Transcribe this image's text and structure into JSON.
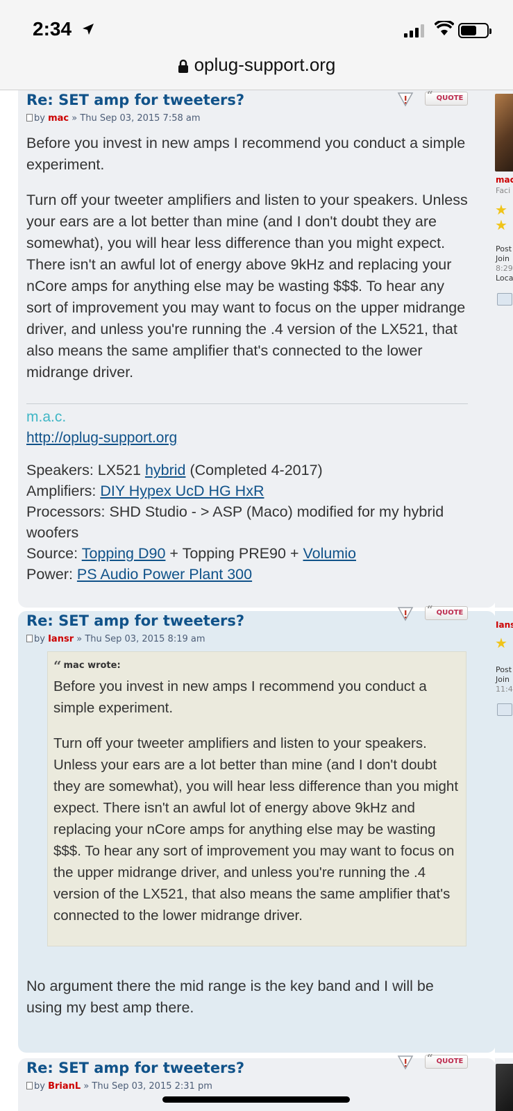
{
  "status_bar": {
    "time": "2:34",
    "url": "oplug-support.org"
  },
  "posts": [
    {
      "title": "Re: SET amp for tweeters?",
      "by": "by",
      "author": "mac",
      "date": "» Thu Sep 03, 2015 7:58 am",
      "quote_label": "QUOTE",
      "paragraphs": [
        "Before you invest in new amps I recommend you conduct a simple experiment.",
        "Turn off your tweeter amplifiers and listen to your speakers. Unless your ears are a lot better than mine (and I don't doubt they are somewhat), you will hear less difference than you might expect. There isn't an awful lot of energy above 9kHz and replacing your nCore amps for anything else may be wasting $$$. To hear any sort of improvement you may want to focus on the upper midrange driver, and unless you're running the .4 version of the LX521, that also means the same amplifier that's connected to the lower midrange driver."
      ],
      "signature": {
        "name": "m.a.c.",
        "link": "http://oplug-support.org",
        "speakers_label": "Speakers: LX521",
        "speakers_link": "hybrid",
        "speakers_suffix": "(Completed 4-2017)",
        "amplifiers_label": "Amplifiers:",
        "amplifiers_link": "DIY Hypex UcD HG HxR",
        "processors": "Processors: SHD Studio - > ASP (Maco) modified for my hybrid woofers",
        "source_label": "Source:",
        "source_link1": "Topping D90",
        "source_mid": "+ Topping PRE90 +",
        "source_link2": "Volumio",
        "power_label": "Power:",
        "power_link": "PS Audio Power Plant 300"
      },
      "profile": {
        "name": "mac",
        "rank": "Faci",
        "posts": "Post",
        "joined": "Join",
        "time": "8:29",
        "location": "Loca"
      }
    },
    {
      "title": "Re: SET amp for tweeters?",
      "by": "by",
      "author": "Iansr",
      "date": "» Thu Sep 03, 2015 8:19 am",
      "quote_label": "QUOTE",
      "quote": {
        "cite": "mac wrote:",
        "paragraphs": [
          "Before you invest in new amps I recommend you conduct a simple experiment.",
          "Turn off your tweeter amplifiers and listen to your speakers. Unless your ears are a lot better than mine (and I don't doubt they are somewhat), you will hear less difference than you might expect. There isn't an awful lot of energy above 9kHz and replacing your nCore amps for anything else may be wasting $$$. To hear any sort of improvement you may want to focus on the upper midrange driver, and unless you're running the .4 version of the LX521, that also means the same amplifier that's connected to the lower midrange driver."
        ]
      },
      "reply": "No argument there the mid range is the key band and I will be using my best amp there.",
      "profile": {
        "name": "Ians",
        "posts": "Post",
        "joined": "Join",
        "time": "11:4"
      }
    },
    {
      "title": "Re: SET amp for tweeters?",
      "by": "by",
      "author": "BrianL",
      "date": "» Thu Sep 03, 2015 2:31 pm",
      "quote_label": "QUOTE"
    }
  ]
}
